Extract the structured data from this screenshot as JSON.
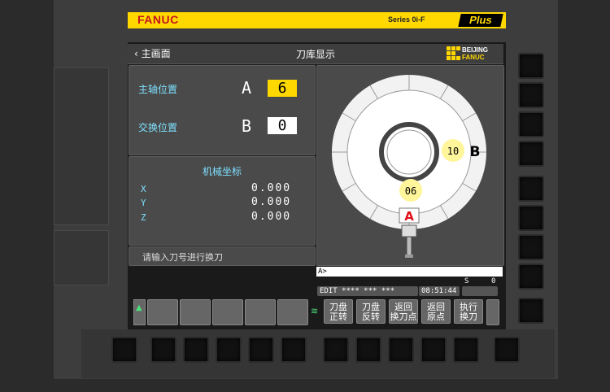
{
  "brand": {
    "name": "FANUC",
    "series": "Series 0i-F",
    "plus": "Plus"
  },
  "header": {
    "back_label": "主画面",
    "title": "刀库显示",
    "logo_line1": "BEIJING",
    "logo_line2": "FANUC"
  },
  "spindle": {
    "label": "主轴位置",
    "letter": "A",
    "value": "6"
  },
  "exchange": {
    "label": "交换位置",
    "letter": "B",
    "value": "0"
  },
  "machine": {
    "title": "机械坐标",
    "axes": [
      {
        "name": "X",
        "value": "0.000"
      },
      {
        "name": "Y",
        "value": "0.000"
      },
      {
        "name": "Z",
        "value": "0.000"
      }
    ]
  },
  "message": "请输入刀号进行换刀",
  "magazine": {
    "tool_b": "10",
    "pos_b": "B",
    "tool_a": "06",
    "pos_a": "A"
  },
  "input_prompt": "A>",
  "status": {
    "s_label": "S",
    "s_value": "0",
    "mode": "EDIT **** *** ***",
    "time": "08:51:44"
  },
  "softkeys": [
    {
      "line1": "刀盘",
      "line2": "正转"
    },
    {
      "line1": "刀盘",
      "line2": "反转"
    },
    {
      "line1": "返回",
      "line2": "换刀点"
    },
    {
      "line1": "返回",
      "line2": "原点"
    },
    {
      "line1": "执行",
      "line2": "换刀"
    }
  ]
}
